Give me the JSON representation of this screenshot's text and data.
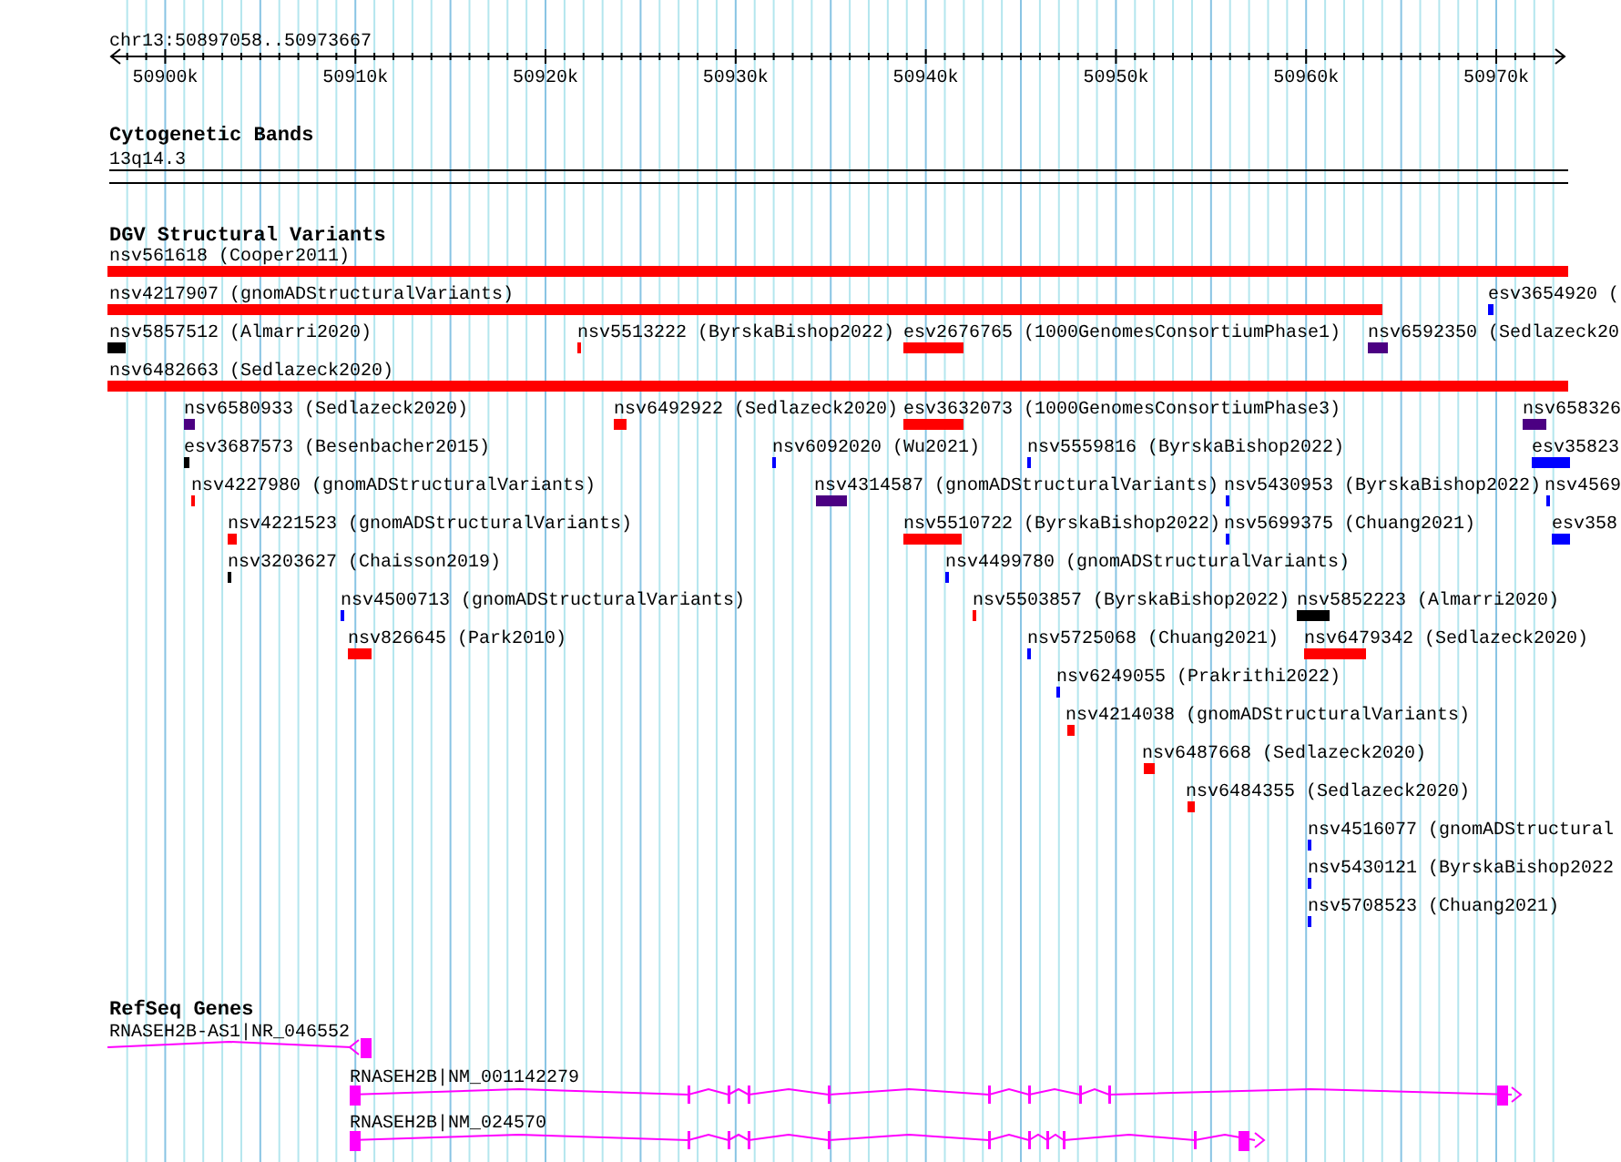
{
  "ruler": {
    "position": "chr13:50897058..50973667",
    "ticks": [
      "50900k",
      "50910k",
      "50920k",
      "50930k",
      "50940k",
      "50950k",
      "50960k",
      "50970k"
    ]
  },
  "tracks": [
    {
      "kind": "cytoband",
      "title": "Cytogenetic Bands",
      "band": "13q14.3"
    },
    {
      "kind": "variants",
      "title": "DGV Structural Variants",
      "features": [
        {
          "label": "nsv561618 (Cooper2011)",
          "color": "#ff0000"
        },
        {
          "label": "nsv4217907 (gnomADStructuralVariants)",
          "color": "#ff0000"
        },
        {
          "label": "esv3654920 (",
          "color": "#0000ff"
        },
        {
          "label": "nsv5857512 (Almarri2020)",
          "color": "#000000"
        },
        {
          "label": "nsv5513222 (ByrskaBishop2022)",
          "color": "#ff0000"
        },
        {
          "label": "esv2676765 (1000GenomesConsortiumPhase1)",
          "color": "#ff0000"
        },
        {
          "label": "nsv6592350 (Sedlazeck20",
          "color": "#4b0082"
        },
        {
          "label": "nsv6482663 (Sedlazeck2020)",
          "color": "#ff0000"
        },
        {
          "label": "nsv6580933 (Sedlazeck2020)",
          "color": "#4b0082"
        },
        {
          "label": "nsv6492922 (Sedlazeck2020)",
          "color": "#ff0000"
        },
        {
          "label": "esv3632073 (1000GenomesConsortiumPhase3)",
          "color": "#ff0000"
        },
        {
          "label": "nsv658326",
          "color": "#4b0082"
        },
        {
          "label": "esv3687573 (Besenbacher2015)",
          "color": "#000000"
        },
        {
          "label": "nsv6092020 (Wu2021)",
          "color": "#0000ff"
        },
        {
          "label": "nsv5559816 (ByrskaBishop2022)",
          "color": "#0000ff"
        },
        {
          "label": "esv35823",
          "color": "#0000ff"
        },
        {
          "label": "nsv4227980 (gnomADStructuralVariants)",
          "color": "#ff0000"
        },
        {
          "label": "nsv4314587 (gnomADStructuralVariants)",
          "color": "#4b0082"
        },
        {
          "label": "nsv5430953 (ByrskaBishop2022)",
          "color": "#0000ff"
        },
        {
          "label": "nsv4569",
          "color": "#0000ff"
        },
        {
          "label": "nsv4221523 (gnomADStructuralVariants)",
          "color": "#ff0000"
        },
        {
          "label": "nsv5510722 (ByrskaBishop2022)",
          "color": "#ff0000"
        },
        {
          "label": "nsv5699375 (Chuang2021)",
          "color": "#0000ff"
        },
        {
          "label": "esv358",
          "color": "#0000ff"
        },
        {
          "label": "nsv3203627 (Chaisson2019)",
          "color": "#000000"
        },
        {
          "label": "nsv4499780 (gnomADStructuralVariants)",
          "color": "#0000ff"
        },
        {
          "label": "nsv4500713 (gnomADStructuralVariants)",
          "color": "#0000ff"
        },
        {
          "label": "nsv5503857 (ByrskaBishop2022)",
          "color": "#ff0000"
        },
        {
          "label": "nsv5852223 (Almarri2020)",
          "color": "#000000"
        },
        {
          "label": "nsv826645 (Park2010)",
          "color": "#ff0000"
        },
        {
          "label": "nsv5725068 (Chuang2021)",
          "color": "#0000ff"
        },
        {
          "label": "nsv6479342 (Sedlazeck2020)",
          "color": "#ff0000"
        },
        {
          "label": "nsv6249055 (Prakrithi2022)",
          "color": "#0000ff"
        },
        {
          "label": "nsv4214038 (gnomADStructuralVariants)",
          "color": "#ff0000"
        },
        {
          "label": "nsv6487668 (Sedlazeck2020)",
          "color": "#ff0000"
        },
        {
          "label": "nsv6484355 (Sedlazeck2020)",
          "color": "#ff0000"
        },
        {
          "label": "nsv4516077 (gnomADStructural",
          "color": "#0000ff"
        },
        {
          "label": "nsv5430121 (ByrskaBishop2022",
          "color": "#0000ff"
        },
        {
          "label": "nsv5708523 (Chuang2021)",
          "color": "#0000ff"
        }
      ]
    },
    {
      "kind": "genes",
      "title": "RefSeq Genes",
      "genes": [
        {
          "label": "RNASEH2B-AS1|NR_046552"
        },
        {
          "label": "RNASEH2B|NM_001142279"
        },
        {
          "label": "RNASEH2B|NM_024570"
        }
      ]
    }
  ]
}
